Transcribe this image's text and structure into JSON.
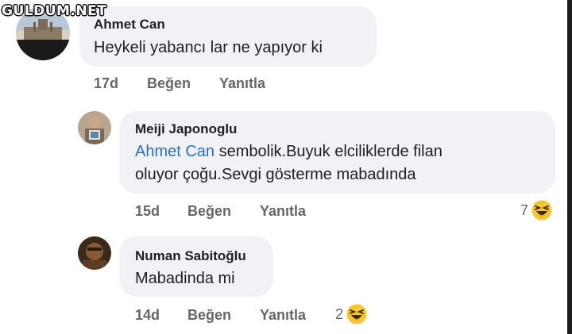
{
  "watermark": "GULDUM.NET",
  "comments": [
    {
      "author": "Ahmet Can",
      "text": "Heykeli yabancı lar ne yapıyor ki",
      "time": "17d",
      "like_label": "Beğen",
      "reply_label": "Yanıtla"
    },
    {
      "author": "Meiji Japonoglu",
      "mention": "Ahmet Can",
      "text_line1": " sembolik.Buyuk elciliklerde filan",
      "text_line2": "oluyor çoğu.Sevgi gösterme mabadında",
      "time": "15d",
      "like_label": "Beğen",
      "reply_label": "Yanıtla",
      "reaction_count": "7",
      "reaction_icon": "laughing-emoji-icon"
    },
    {
      "author": "Numan Sabitoğlu",
      "text": "Mabadinda mi",
      "time": "14d",
      "like_label": "Beğen",
      "reply_label": "Yanıtla",
      "reaction_count": "2",
      "reaction_icon": "laughing-emoji-icon"
    }
  ],
  "colors": {
    "bubble": "#f0f2f5",
    "mention": "#2d6fc6",
    "meta": "#65676b"
  }
}
